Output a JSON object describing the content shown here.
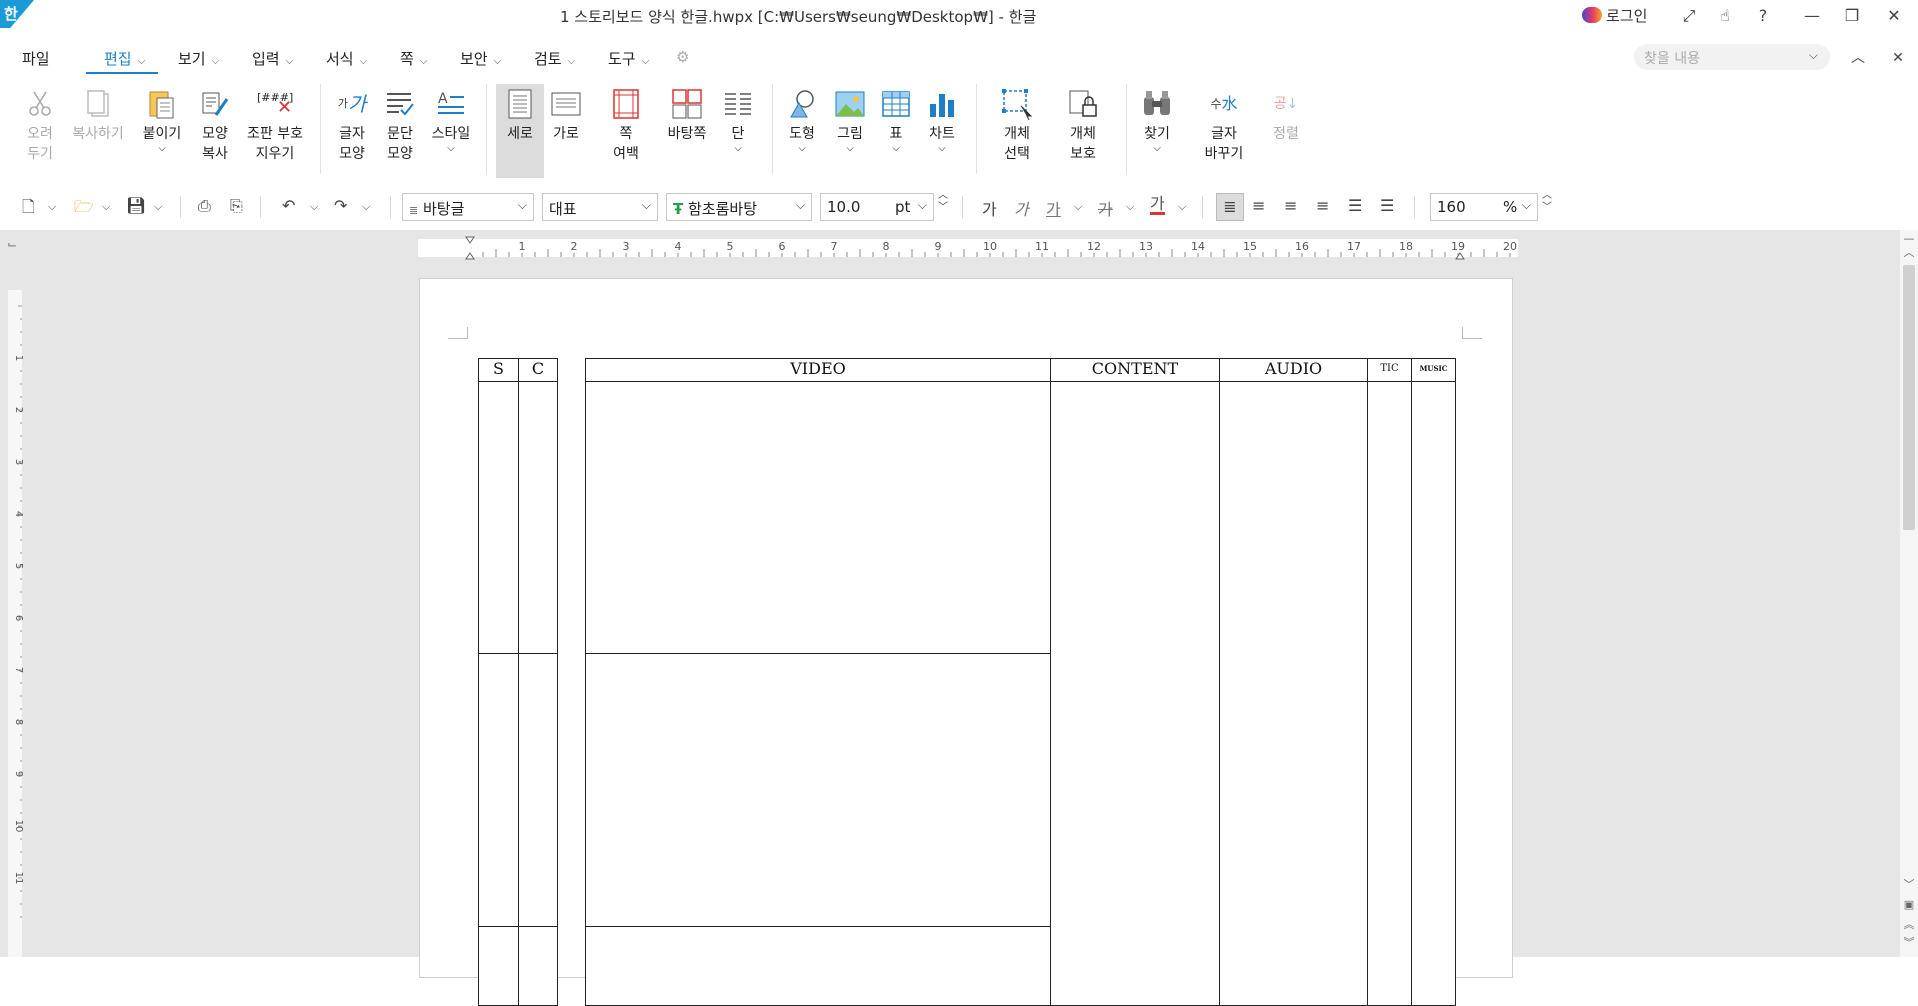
{
  "window": {
    "logo": "한",
    "title": "1 스토리보드 양식 한글.hwpx [C:₩Users₩seung₩Desktop₩] - 한글",
    "login": "로그인",
    "help": "?"
  },
  "menu": {
    "file": "파일",
    "items": [
      "편집",
      "보기",
      "입력",
      "서식",
      "쪽",
      "보안",
      "검토",
      "도구"
    ],
    "search_placeholder": "찾을 내용"
  },
  "ribbon": {
    "cut": "오려\n두기",
    "copy": "복사하기",
    "paste": "붙이기",
    "format_copy": "모양\n복사",
    "remove_codes": "조판 부호\n지우기",
    "remove_codes_icon_text": "[###]",
    "char_shape": "글자\n모양",
    "para_shape": "문단\n모양",
    "style": "스타일",
    "portrait": "세로",
    "landscape": "가로",
    "page_margin": "쪽\n여백",
    "master_page": "바탕쪽",
    "columns": "단",
    "shape": "도형",
    "picture": "그림",
    "table": "표",
    "chart": "차트",
    "select_object": "개체\n선택",
    "protect_object": "개체\n보호",
    "find": "찾기",
    "replace_char": "글자\n바꾸기",
    "sort": "정렬"
  },
  "toolbar": {
    "style_value": "바탕글",
    "outline_value": "대표",
    "font_value": "함초롬바탕",
    "font_size": "10.0",
    "font_unit": "pt",
    "bold_glyph": "가",
    "italic_glyph": "가",
    "underline_glyph": "가",
    "strike_glyph": "가",
    "color_glyph": "가",
    "zoom_value": "160",
    "zoom_unit": "%"
  },
  "ruler": {
    "h_ticks": [
      "1",
      "2",
      "3",
      "4",
      "5",
      "6",
      "7",
      "8",
      "9",
      "10",
      "11",
      "12",
      "13",
      "14",
      "15",
      "16",
      "17",
      "18",
      "19",
      "20"
    ],
    "v_ticks": [
      "1",
      "2",
      "3",
      "4",
      "5",
      "6",
      "7",
      "8",
      "9",
      "10",
      "11"
    ]
  },
  "storyboard": {
    "headers": {
      "s": "S",
      "c": "C",
      "video": "VIDEO",
      "content": "CONTENT",
      "audio": "AUDIO",
      "tic": "TIC",
      "music": "MUSIC"
    }
  },
  "colors": {
    "accent": "#1f7fc6",
    "doc_bg": "#e6e6e6",
    "page_bg": "#ffffff"
  }
}
